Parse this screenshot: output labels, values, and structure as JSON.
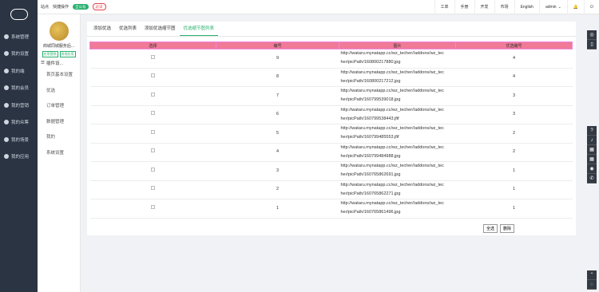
{
  "topbar": {
    "site_label": "站点",
    "quick_label": "快捷操作",
    "badge_green": "全公号",
    "badge_red": "必读",
    "right_buttons": [
      "工单",
      "手册",
      "开发",
      "市场"
    ],
    "language": "English",
    "user": "admin"
  },
  "sidebar": {
    "items": [
      {
        "label": "系统管理",
        "icon": "gear-icon"
      },
      {
        "label": "我的设置",
        "icon": "settings-icon"
      },
      {
        "label": "我的端",
        "icon": "app-icon"
      },
      {
        "label": "我的会员",
        "icon": "user-icon"
      },
      {
        "label": "我的营销",
        "icon": "marketing-icon"
      },
      {
        "label": "我的众筹",
        "icon": "crowd-icon"
      },
      {
        "label": "我的场景",
        "icon": "scene-icon"
      },
      {
        "label": "我的应用",
        "icon": "apps-icon"
      }
    ]
  },
  "subnav": {
    "shop_name": "商城同城服务后...",
    "tag1": "应用营销",
    "tag2": "其他应用",
    "group": "插件设...",
    "items": [
      "首页基本设置",
      "优选",
      "订单管理",
      "数据管理",
      "我的",
      "系统设置"
    ]
  },
  "tabs": [
    "添加优选",
    "优选列表",
    "添加优选缩节图",
    "优选缩节图列表"
  ],
  "active_tab": 3,
  "table": {
    "headers": [
      "选择",
      "编号",
      "图片",
      "优选编号"
    ],
    "rows": [
      {
        "id": "9",
        "path1": "http://wataru.mynatapp.cc/wz_techer//addons/wz_tec",
        "path2": "her/picPath/160800217880.jpg",
        "num": "4"
      },
      {
        "id": "8",
        "path1": "http://wataru.mynatapp.cc/wz_techer//addons/wz_tec",
        "path2": "her/picPath/160800217212.jpg",
        "num": "4"
      },
      {
        "id": "7",
        "path1": "http://wataru.mynatapp.cc/wz_techer//addons/wz_tec",
        "path2": "her/picPath/160799539018.jpg",
        "num": "3"
      },
      {
        "id": "6",
        "path1": "http://wataru.mynatapp.cc/wz_techer//addons/wz_tec",
        "path2": "her/picPath/160799538443.jfif",
        "num": "3"
      },
      {
        "id": "5",
        "path1": "http://wataru.mynatapp.cc/wz_techer//addons/wz_tec",
        "path2": "her/picPath/160799485553.jfif",
        "num": "2"
      },
      {
        "id": "4",
        "path1": "http://wataru.mynatapp.cc/wz_techer//addons/wz_tec",
        "path2": "her/picPath/160799484988.jpg",
        "num": "2"
      },
      {
        "id": "3",
        "path1": "http://wataru.mynatapp.cc/wz_techer//addons/wz_tec",
        "path2": "her/picPath/160765862691.jpg",
        "num": "1"
      },
      {
        "id": "2",
        "path1": "http://wataru.mynatapp.cc/wz_techer//addons/wz_tec",
        "path2": "her/picPath/160765862271.jpg",
        "num": "1"
      },
      {
        "id": "1",
        "path1": "http://wataru.mynatapp.cc/wz_techer//addons/wz_tec",
        "path2": "her/picPath/160765861496.jpg",
        "num": "1"
      }
    ]
  },
  "buttons": {
    "select_all": "全选",
    "delete": "删除"
  }
}
